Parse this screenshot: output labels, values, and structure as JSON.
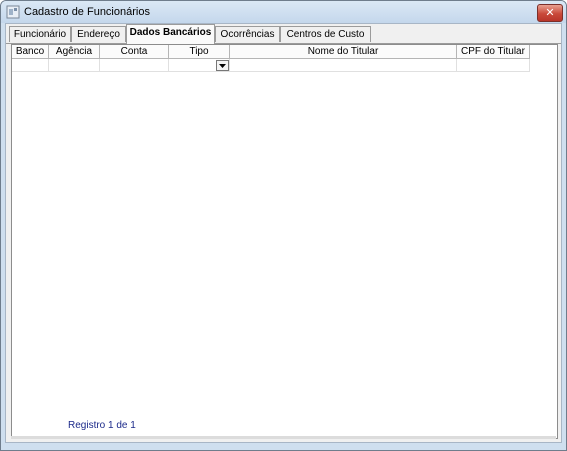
{
  "window": {
    "title": "Cadastro de Funcionários",
    "close_label": "✕"
  },
  "tabs": [
    {
      "label": "Funcionário",
      "active": false
    },
    {
      "label": "Endereço",
      "active": false
    },
    {
      "label": "Dados Bancários",
      "active": true
    },
    {
      "label": "Ocorrências",
      "active": false
    },
    {
      "label": "Centros de Custo",
      "active": false
    }
  ],
  "grid": {
    "columns": [
      "Banco",
      "Agência",
      "Conta",
      "Tipo",
      "Nome do Titular",
      "CPF do Titular"
    ],
    "rows": [
      [
        "",
        "",
        "",
        "",
        "",
        ""
      ]
    ]
  },
  "footer": {
    "record_status": "Registro 1 de 1"
  },
  "colors": {
    "title_bar": "#c4d7ec",
    "close_button": "#c9493a",
    "footer_text": "#1c2a8a"
  }
}
